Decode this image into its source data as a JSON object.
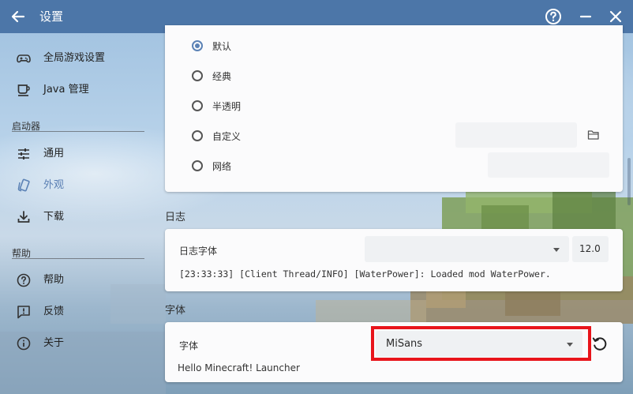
{
  "window": {
    "title": "设置",
    "colors": {
      "titlebar": "#4c76a8",
      "accent": "#5b82b5",
      "highlight": "#e8141b"
    }
  },
  "titlebar_icons": [
    "back-arrow-icon",
    "help-icon",
    "minimize-icon",
    "close-icon"
  ],
  "sidebar": {
    "top_items": [
      {
        "label": "全局游戏设置",
        "icon": "gamepad-icon"
      },
      {
        "label": "Java 管理",
        "icon": "coffee-cup-icon"
      }
    ],
    "launcher_section": {
      "title": "启动器",
      "items": [
        {
          "label": "通用",
          "icon": "sliders-icon"
        },
        {
          "label": "外观",
          "icon": "theme-icon",
          "active": true
        },
        {
          "label": "下载",
          "icon": "download-icon"
        }
      ]
    },
    "help_section": {
      "title": "帮助",
      "items": [
        {
          "label": "帮助",
          "icon": "help-circle-icon"
        },
        {
          "label": "反馈",
          "icon": "feedback-icon"
        },
        {
          "label": "关于",
          "icon": "info-icon"
        }
      ]
    }
  },
  "background_options": {
    "items": [
      {
        "label": "默认",
        "checked": true
      },
      {
        "label": "经典",
        "checked": false
      },
      {
        "label": "半透明",
        "checked": false
      },
      {
        "label": "自定义",
        "checked": false
      },
      {
        "label": "网络",
        "checked": false
      }
    ],
    "custom_value": "",
    "network_value": ""
  },
  "log": {
    "section_title": "日志",
    "font_label": "日志字体",
    "font_value": "",
    "font_size": "12.0",
    "preview": "[23:33:33] [Client Thread/INFO] [WaterPower]: Loaded mod WaterPower."
  },
  "font": {
    "section_title": "字体",
    "font_label": "字体",
    "font_value": "MiSans",
    "preview": "Hello Minecraft! Launcher"
  }
}
